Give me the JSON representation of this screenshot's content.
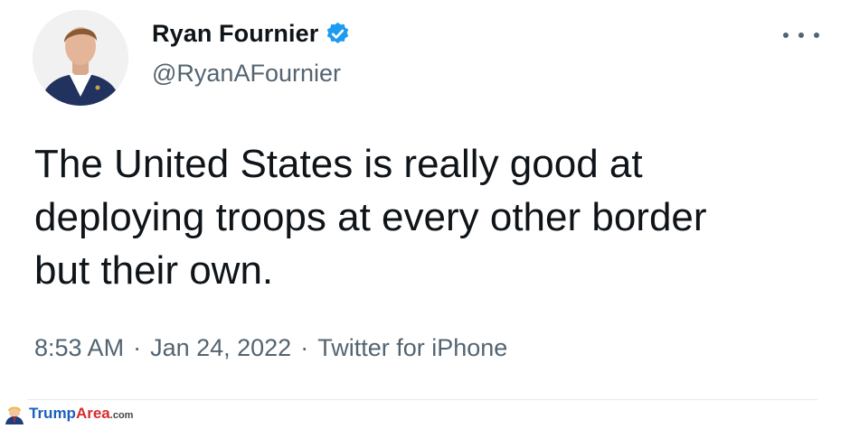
{
  "author": {
    "display_name": "Ryan Fournier",
    "handle": "@RyanAFournier",
    "verified": true
  },
  "tweet": {
    "text": "The United States is really good at\ndeploying troops at every other border\nbut their own."
  },
  "meta": {
    "time": "8:53 AM",
    "separator": "·",
    "date": "Jan 24, 2022",
    "source": "Twitter for iPhone"
  },
  "icons": {
    "verified": "verified-badge-icon",
    "more": "more-options-icon"
  },
  "colors": {
    "verified_blue": "#1d9bf0",
    "text_primary": "#0f1419",
    "text_secondary": "#536471"
  },
  "watermark": {
    "brand_part1": "Trump",
    "brand_part2": "Area",
    "brand_suffix": ".com"
  }
}
